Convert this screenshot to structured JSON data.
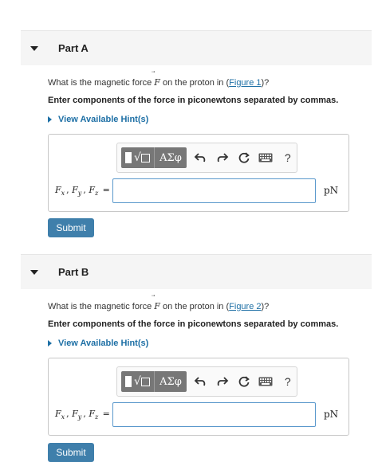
{
  "parts": [
    {
      "title": "Part A",
      "question_prefix": "What is the magnetic force ",
      "force_symbol": "F",
      "question_middle": " on the proton in (",
      "figure_link": "Figure 1",
      "question_suffix": ")?",
      "instruction": "Enter components of the force in piconewtons separated by commas.",
      "hint_label": "View Available Hint(s)",
      "greek_button": "ΑΣφ",
      "help_button": "?",
      "answer_value": "",
      "unit": "pN",
      "submit_label": "Submit"
    },
    {
      "title": "Part B",
      "question_prefix": "What is the magnetic force ",
      "force_symbol": "F",
      "question_middle": " on the proton in (",
      "figure_link": "Figure 2",
      "question_suffix": ")?",
      "instruction": "Enter components of the force in piconewtons separated by commas.",
      "hint_label": "View Available Hint(s)",
      "greek_button": "ΑΣφ",
      "help_button": "?",
      "answer_value": "",
      "unit": "pN",
      "submit_label": "Submit"
    }
  ],
  "math_label": {
    "fx_base": "F",
    "fx_sub": "x",
    "fy_base": "F",
    "fy_sub": "y",
    "fz_base": "F",
    "fz_sub": "z",
    "sep": ", ",
    "eq": " ="
  },
  "icons": {
    "caret": "caret-down-icon",
    "hint": "triangle-right-icon",
    "undo": "undo-icon",
    "redo": "redo-icon",
    "reset": "reset-icon",
    "keyboard": "keyboard-icon"
  },
  "colors": {
    "link": "#1d6fa5",
    "submit_bg": "#3f7fab",
    "input_border": "#5a98cc",
    "header_bg": "#f5f5f5"
  }
}
